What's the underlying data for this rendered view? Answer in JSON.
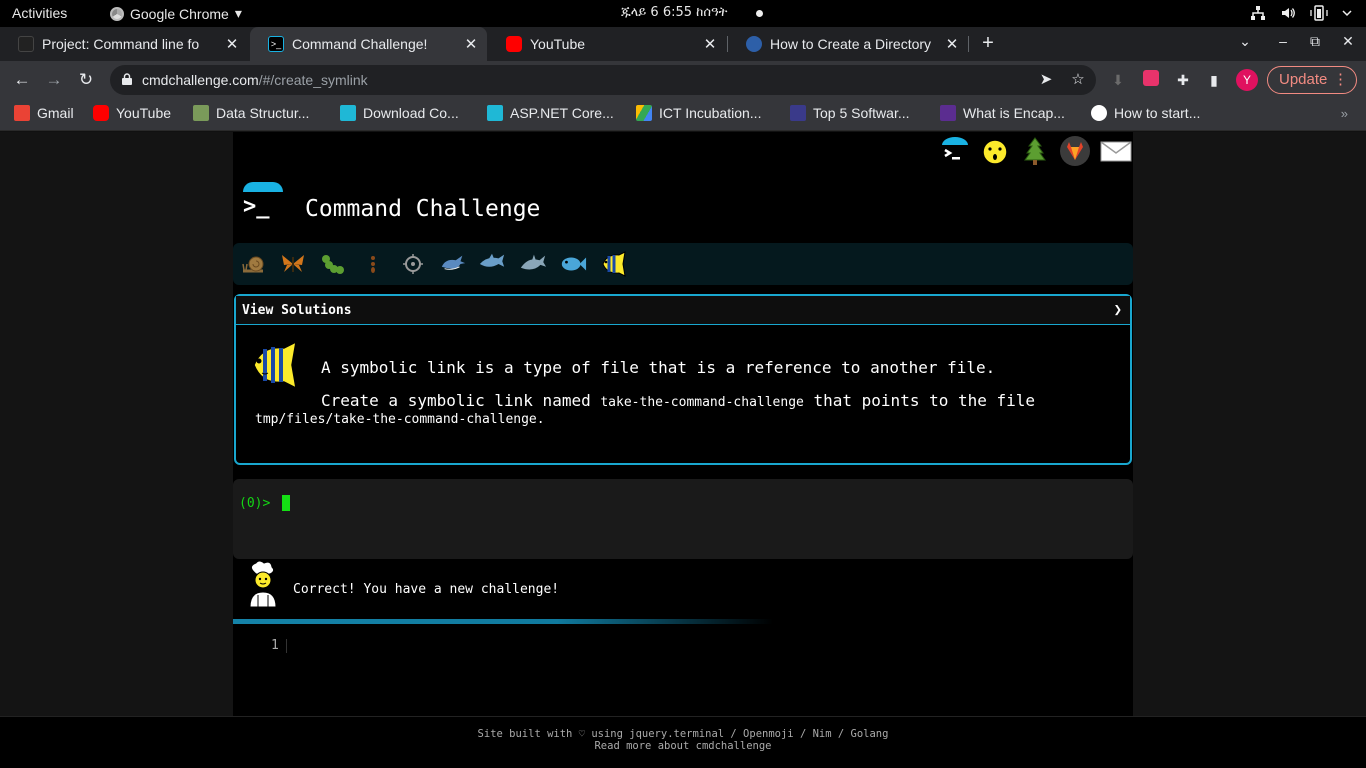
{
  "system_bar": {
    "activities": "Activities",
    "app_name": "Google Chrome",
    "app_menu_arrow": "▾",
    "clock": "ጁላይ 6  6:55 ከሰዓት"
  },
  "tabs": [
    {
      "title": "Project: Command line fo",
      "active": false
    },
    {
      "title": "Command Challenge!",
      "active": true
    },
    {
      "title": "YouTube",
      "active": false
    },
    {
      "title": "How to Create a Directory",
      "active": false
    }
  ],
  "toolbar": {
    "url_host": "cmdchallenge.com",
    "url_path": "/#/create_symlink",
    "update_label": "Update",
    "avatar_letter": "Y"
  },
  "bookmarks": [
    {
      "label": "Gmail",
      "icon": "gmail-icon",
      "color": "#ea4335"
    },
    {
      "label": "YouTube",
      "icon": "youtube-icon",
      "color": "#ff0000"
    },
    {
      "label": "Data Structur...",
      "icon": "data-structures-icon",
      "color": "#7a9a5a"
    },
    {
      "label": "Download Co...",
      "icon": "download-icon",
      "color": "#1fb8d6"
    },
    {
      "label": "ASP.NET Core...",
      "icon": "aspnet-icon",
      "color": "#1fb8d6"
    },
    {
      "label": "ICT Incubation...",
      "icon": "google-drive-icon",
      "color": "#fbbc04"
    },
    {
      "label": "Top 5 Softwar...",
      "icon": "top5-icon",
      "color": "#3a3a8a"
    },
    {
      "label": "What is Encap...",
      "icon": "sumo-icon",
      "color": "#5b2d90"
    },
    {
      "label": "How to start...",
      "icon": "globe-icon",
      "color": "#ffffff"
    }
  ],
  "page": {
    "site_title": "Command Challenge",
    "logo_prompt": ">_",
    "view_solutions": "View Solutions",
    "chevron": "❯",
    "line1": "A symbolic link is a type of file that is a reference to another file.",
    "line2_pre": "Create a symbolic link named ",
    "line2_code": "take-the-command-challenge",
    "line2_post": " that points to the file",
    "line3": "tmp/files/take-the-command-challenge.",
    "prompt": "(0)>",
    "correct_msg": "Correct! You have a new challenge!",
    "editor_line_no": "1"
  },
  "footer": {
    "line1": "Site built with ♡ using jquery.terminal / Openmoji / Nim / Golang",
    "line2": "Read more about cmdchallenge"
  },
  "colors": {
    "accent": "#19a7cf",
    "prompt_green": "#14d614",
    "update_red": "#f28b82"
  }
}
